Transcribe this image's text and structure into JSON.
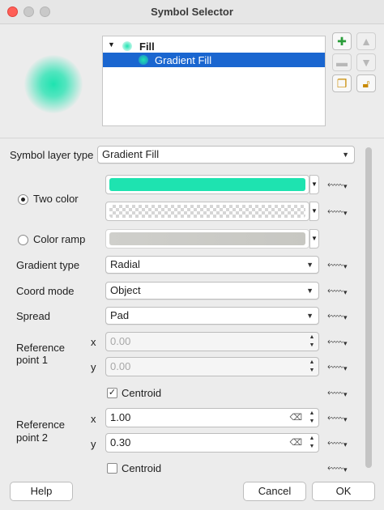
{
  "window": {
    "title": "Symbol Selector"
  },
  "tree": {
    "parent_label": "Fill",
    "child_label": "Gradient Fill"
  },
  "side_buttons": {
    "add": "add-layer",
    "remove": "remove-layer",
    "up": "move-up",
    "down": "move-down",
    "duplicate": "duplicate-layer",
    "lock": "lock-layer"
  },
  "form": {
    "symbol_layer_type_label": "Symbol layer type",
    "symbol_layer_type_value": "Gradient Fill",
    "two_color_label": "Two color",
    "color_ramp_label": "Color ramp",
    "gradient_type_label": "Gradient type",
    "gradient_type_value": "Radial",
    "coord_mode_label": "Coord mode",
    "coord_mode_value": "Object",
    "spread_label": "Spread",
    "spread_value": "Pad",
    "ref1_label_line1": "Reference",
    "ref1_label_line2": "point 1",
    "ref1_x_label": "x",
    "ref1_x_value": "0.00",
    "ref1_y_label": "y",
    "ref1_y_value": "0.00",
    "ref1_centroid_label": "Centroid",
    "ref2_label_line1": "Reference",
    "ref2_label_line2": "point 2",
    "ref2_x_label": "x",
    "ref2_x_value": "1.00",
    "ref2_y_label": "y",
    "ref2_y_value": "0.30",
    "ref2_centroid_label": "Centroid"
  },
  "colors": {
    "color1": "#1ee3b0",
    "color2": "transparent",
    "accent": "#1a66d0"
  },
  "buttons": {
    "help": "Help",
    "cancel": "Cancel",
    "ok": "OK"
  }
}
